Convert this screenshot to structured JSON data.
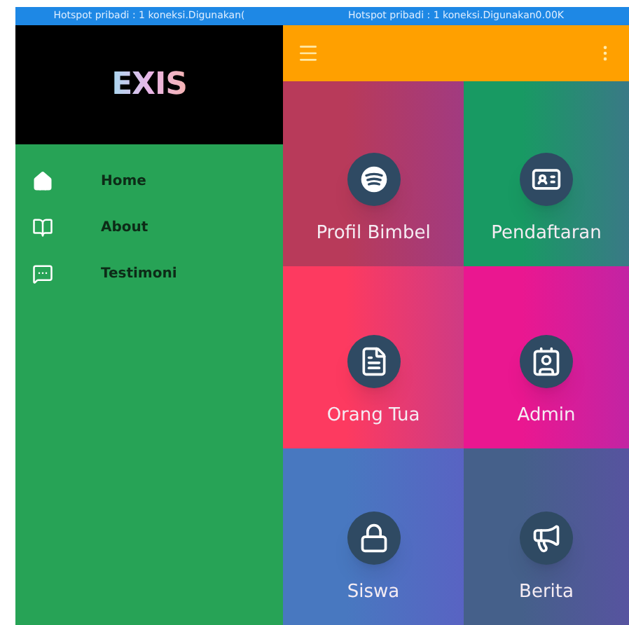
{
  "status_bar": {
    "left_text": "Hotspot pribadi : 1 koneksi.Digunakan(",
    "right_text": "Hotspot pribadi : 1 koneksi.Digunakan0.00K"
  },
  "drawer": {
    "logo": "EXIS",
    "items": [
      {
        "label": "Home"
      },
      {
        "label": "About"
      },
      {
        "label": "Testimoni"
      }
    ]
  },
  "tiles": [
    {
      "label": "Profil Bimbel",
      "color": "#b83a5a"
    },
    {
      "label": "Pendaftaran",
      "color": "#189a63"
    },
    {
      "label": "Orang Tua",
      "color": "#fd3a60"
    },
    {
      "label": "Admin",
      "color": "#ea1790"
    },
    {
      "label": "Siswa",
      "color": "#4878c0"
    },
    {
      "label": "Berita",
      "color": "#45608a"
    }
  ]
}
